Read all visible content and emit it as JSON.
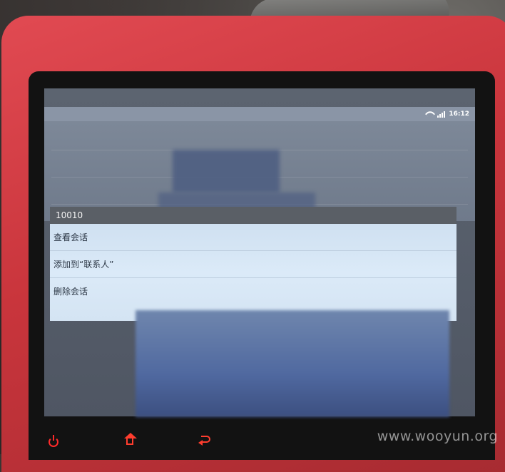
{
  "status_bar": {
    "time": "16:12",
    "icons": [
      "wifi-icon",
      "signal-icon"
    ]
  },
  "dialog": {
    "title": "10010",
    "items": [
      {
        "label": "查看会话"
      },
      {
        "label": "添加到“联系人”"
      },
      {
        "label": "删除会话"
      }
    ]
  },
  "nav_bar": {
    "icons": [
      "power-icon",
      "home-icon",
      "back-icon"
    ]
  },
  "watermark": "www.wooyun.org"
}
